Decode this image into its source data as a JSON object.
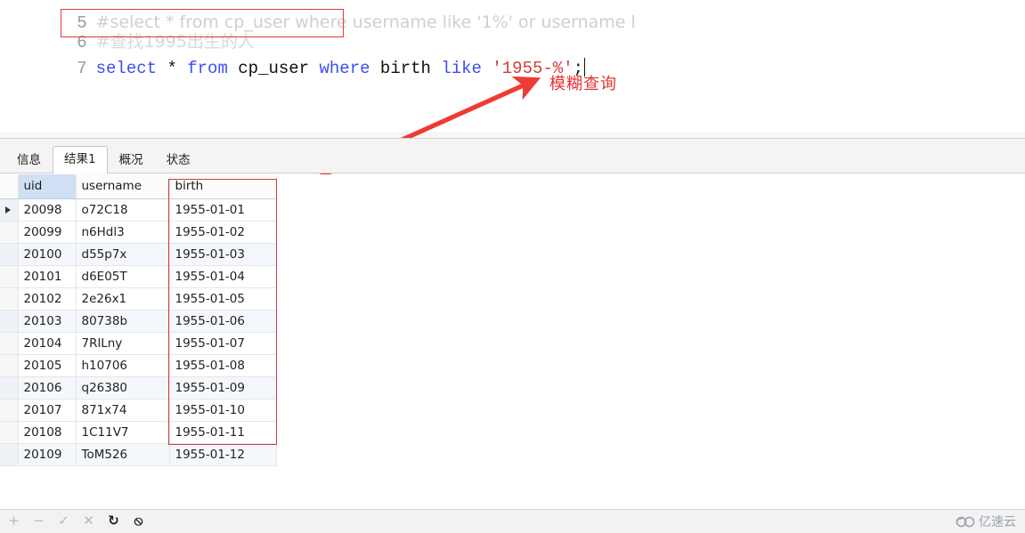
{
  "editor": {
    "lines": [
      {
        "number": "5",
        "text": "#select * from cp_user where username like '1%' or username l",
        "style": "comment"
      },
      {
        "number": "6",
        "text": "#查找1995出生的人",
        "style": "comment"
      },
      {
        "number": "7",
        "text": "select * from cp_user where birth like '1955-%';",
        "style": "sql"
      }
    ],
    "line7_tokens": {
      "select": "select",
      "star": "*",
      "from": "from",
      "table": "cp_user",
      "where": "where",
      "column": "birth",
      "like": "like",
      "literal": "'1955-%'",
      "semicolon": ";"
    }
  },
  "annotation": {
    "label": "模糊查询",
    "color": "#e8302f"
  },
  "tabs": [
    {
      "label": "信息",
      "active": false
    },
    {
      "label": "结果1",
      "active": true
    },
    {
      "label": "概况",
      "active": false
    },
    {
      "label": "状态",
      "active": false
    }
  ],
  "result_grid": {
    "columns": [
      "uid",
      "username",
      "birth"
    ],
    "selected_column": "uid",
    "current_row_index": 0,
    "rows": [
      {
        "uid": "20098",
        "username": "o72C18",
        "birth": "1955-01-01"
      },
      {
        "uid": "20099",
        "username": "n6Hdl3",
        "birth": "1955-01-02"
      },
      {
        "uid": "20100",
        "username": "d55p7x",
        "birth": "1955-01-03"
      },
      {
        "uid": "20101",
        "username": "d6E05T",
        "birth": "1955-01-04"
      },
      {
        "uid": "20102",
        "username": "2e26x1",
        "birth": "1955-01-05"
      },
      {
        "uid": "20103",
        "username": "80738b",
        "birth": "1955-01-06"
      },
      {
        "uid": "20104",
        "username": "7RlLny",
        "birth": "1955-01-07"
      },
      {
        "uid": "20105",
        "username": "h10706",
        "birth": "1955-01-08"
      },
      {
        "uid": "20106",
        "username": "q26380",
        "birth": "1955-01-09"
      },
      {
        "uid": "20107",
        "username": "871x74",
        "birth": "1955-01-10"
      },
      {
        "uid": "20108",
        "username": "1C11V7",
        "birth": "1955-01-11"
      },
      {
        "uid": "20109",
        "username": "ToM526",
        "birth": "1955-01-12"
      }
    ]
  },
  "toolbar": {
    "icons": [
      {
        "name": "add-record-icon",
        "glyph": "+",
        "enabled": false
      },
      {
        "name": "remove-record-icon",
        "glyph": "−",
        "enabled": false
      },
      {
        "name": "apply-change-icon",
        "glyph": "✓",
        "enabled": false
      },
      {
        "name": "cancel-change-icon",
        "glyph": "✕",
        "enabled": false
      },
      {
        "name": "refresh-icon",
        "glyph": "↻",
        "enabled": true
      },
      {
        "name": "stop-icon",
        "glyph": "⦸",
        "enabled": true
      }
    ]
  },
  "watermark": {
    "text": "亿速云"
  }
}
